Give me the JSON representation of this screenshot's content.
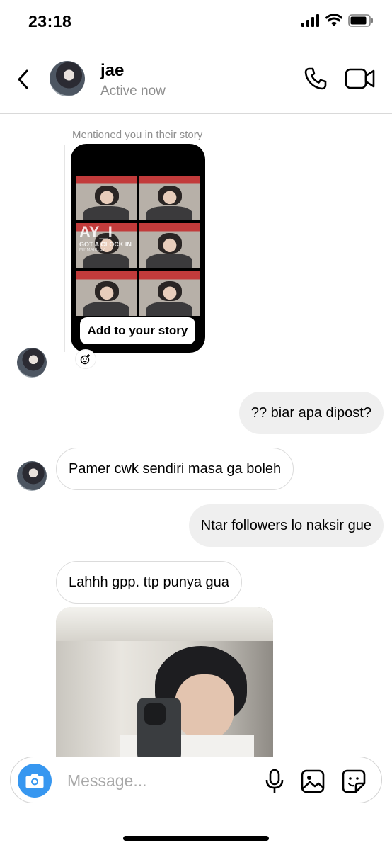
{
  "status_bar": {
    "time": "23:18"
  },
  "header": {
    "name": "jae",
    "status": "Active now"
  },
  "story_mention": {
    "label": "Mentioned you in their story",
    "overlay_title": "AY_I",
    "overlay_subtitle": "GOT A CLOCK IN",
    "overlay_tiny": "MY MARE 17",
    "button": "Add to your story"
  },
  "messages": [
    {
      "from": "me",
      "text": "?? biar apa dipost?"
    },
    {
      "from": "them",
      "text": "Pamer cwk sendiri masa ga boleh"
    },
    {
      "from": "me",
      "text": "Ntar followers lo naksir gue"
    },
    {
      "from": "them",
      "text": "Lahhh gpp. ttp punya gua"
    }
  ],
  "composer": {
    "placeholder": "Message..."
  },
  "colors": {
    "accent": "#3797f0",
    "bubble_out": "#efefef",
    "secondary_text": "#8e8e8e"
  }
}
